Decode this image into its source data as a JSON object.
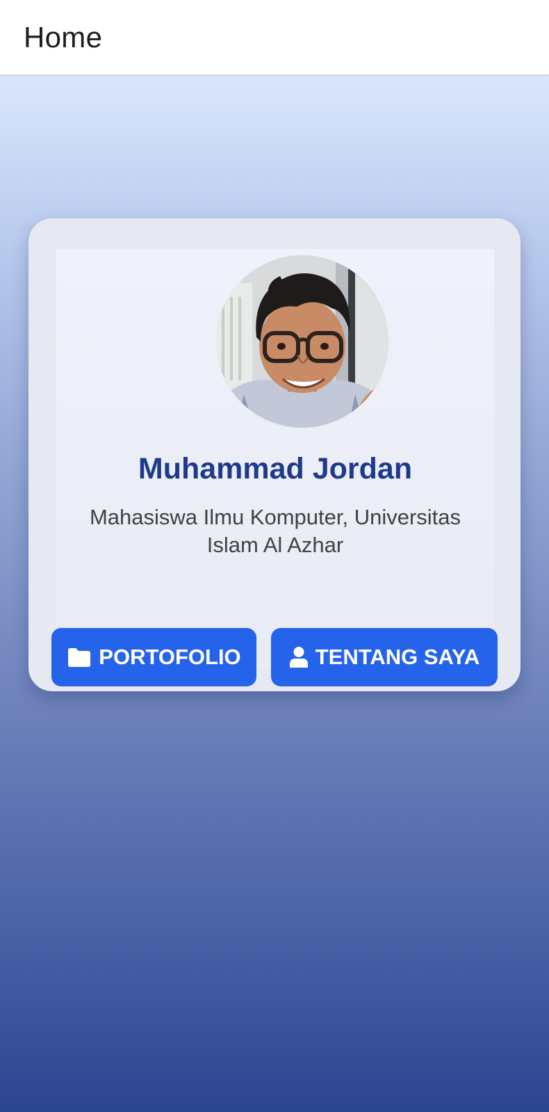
{
  "app_bar": {
    "title": "Home"
  },
  "colors": {
    "accent": "#2563eb",
    "name": "#1f3a8a",
    "gradient_top": "#dae6fd",
    "gradient_bottom": "#2c4590"
  },
  "profile": {
    "avatar": "profile-photo",
    "name": "Muhammad Jordan",
    "description": "Mahasiswa Ilmu Komputer, Universitas Islam Al Azhar"
  },
  "buttons": {
    "portfolio": {
      "icon": "folder-icon",
      "label": "PORTOFOLIO"
    },
    "about": {
      "icon": "user-icon",
      "label": "TENTANG SAYA"
    }
  }
}
